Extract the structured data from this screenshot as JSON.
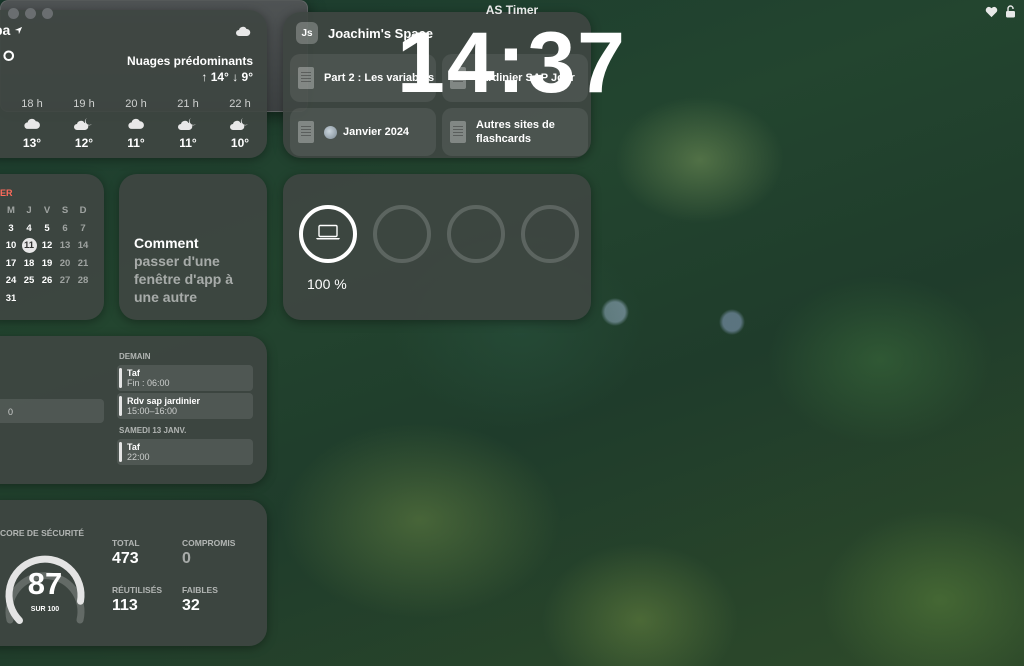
{
  "weather": {
    "city_partial": "pa",
    "temp_partial": "3°",
    "condition": "Nuages prédominants",
    "hilo": "↑ 14° ↓ 9°",
    "hours": [
      {
        "hour": "18 h",
        "icon": "cloud-icon",
        "temp": "13°"
      },
      {
        "hour": "19 h",
        "icon": "cloud-moon-icon",
        "temp": "12°"
      },
      {
        "hour": "20 h",
        "icon": "cloud-icon",
        "temp": "11°"
      },
      {
        "hour": "21 h",
        "icon": "cloud-moon-icon",
        "temp": "11°"
      },
      {
        "hour": "22 h",
        "icon": "cloud-moon-icon",
        "temp": "10°"
      }
    ]
  },
  "space": {
    "avatar": "Js",
    "title": "Joachim's Space",
    "items": [
      {
        "label": "Part 2 : Les variables",
        "icon": "document-icon"
      },
      {
        "label": "Jardinier SAP Jour",
        "icon": "document-icon"
      },
      {
        "label": "Janvier 2024",
        "icon": "globe-icon"
      },
      {
        "label": "Autres sites de flashcards",
        "icon": "document-icon"
      }
    ]
  },
  "timer": {
    "title": "AS Timer",
    "time": "14:37"
  },
  "calendar": {
    "month_partial": "ER",
    "weekdays": [
      "M",
      "J",
      "V",
      "S",
      "D"
    ],
    "weeks": [
      [
        "3",
        "4",
        "5",
        "6",
        "7"
      ],
      [
        "10",
        "11",
        "12",
        "13",
        "14"
      ],
      [
        "17",
        "18",
        "19",
        "20",
        "21"
      ],
      [
        "24",
        "25",
        "26",
        "27",
        "28"
      ],
      [
        "31",
        "",
        "",
        "",
        ""
      ]
    ],
    "today": "11"
  },
  "shortcut": {
    "line1": "Comment",
    "line2": "passer d'une",
    "line3": "fenêtre d'app à",
    "line4": "une autre"
  },
  "battery": {
    "devices": [
      {
        "icon": "laptop-icon",
        "level": 1.0
      },
      {
        "icon": "",
        "level": 0
      },
      {
        "icon": "",
        "level": 0
      },
      {
        "icon": "",
        "level": 0
      }
    ],
    "percent_label": "100 %"
  },
  "agenda": {
    "left_partial": "0",
    "tomorrow_label": "DEMAIN",
    "events_tomorrow": [
      {
        "name": "Taf",
        "time": "Fin : 06:00"
      },
      {
        "name": "Rdv sap jardinier",
        "time": "15:00–16:00"
      }
    ],
    "saturday_label": "SAMEDI 13 JANV.",
    "events_saturday": [
      {
        "name": "Taf",
        "time": "22:00"
      }
    ]
  },
  "security": {
    "header_partial": "CORE DE SÉCURITÉ",
    "score": "87",
    "score_max_label": "SUR 100",
    "score_fraction": 0.87,
    "total_label": "TOTAL",
    "total": "473",
    "compromis_label": "COMPROMIS",
    "compromis": "0",
    "reused_label": "RÉUTILISÉS",
    "reused": "113",
    "weak_label": "FAIBLES",
    "weak": "32"
  },
  "colors": {
    "widget_bg": "#3e4642",
    "calendar_accent": "#ff6b5b"
  }
}
